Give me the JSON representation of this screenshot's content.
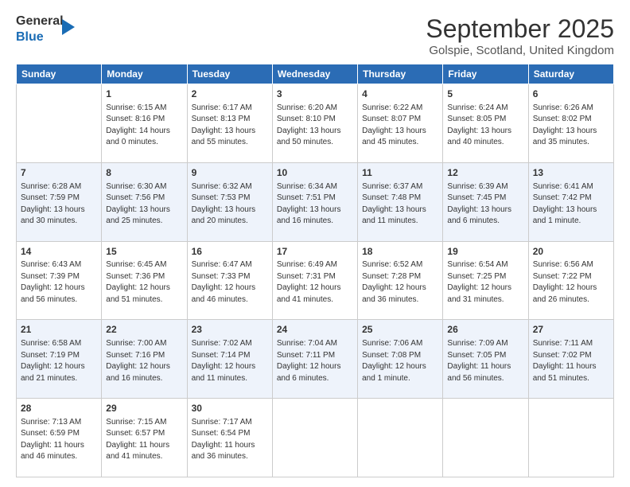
{
  "header": {
    "logo_general": "General",
    "logo_blue": "Blue",
    "title": "September 2025",
    "subtitle": "Golspie, Scotland, United Kingdom"
  },
  "days": [
    "Sunday",
    "Monday",
    "Tuesday",
    "Wednesday",
    "Thursday",
    "Friday",
    "Saturday"
  ],
  "weeks": [
    [
      {
        "num": "",
        "content": ""
      },
      {
        "num": "1",
        "content": "Sunrise: 6:15 AM\nSunset: 8:16 PM\nDaylight: 14 hours\nand 0 minutes."
      },
      {
        "num": "2",
        "content": "Sunrise: 6:17 AM\nSunset: 8:13 PM\nDaylight: 13 hours\nand 55 minutes."
      },
      {
        "num": "3",
        "content": "Sunrise: 6:20 AM\nSunset: 8:10 PM\nDaylight: 13 hours\nand 50 minutes."
      },
      {
        "num": "4",
        "content": "Sunrise: 6:22 AM\nSunset: 8:07 PM\nDaylight: 13 hours\nand 45 minutes."
      },
      {
        "num": "5",
        "content": "Sunrise: 6:24 AM\nSunset: 8:05 PM\nDaylight: 13 hours\nand 40 minutes."
      },
      {
        "num": "6",
        "content": "Sunrise: 6:26 AM\nSunset: 8:02 PM\nDaylight: 13 hours\nand 35 minutes."
      }
    ],
    [
      {
        "num": "7",
        "content": "Sunrise: 6:28 AM\nSunset: 7:59 PM\nDaylight: 13 hours\nand 30 minutes."
      },
      {
        "num": "8",
        "content": "Sunrise: 6:30 AM\nSunset: 7:56 PM\nDaylight: 13 hours\nand 25 minutes."
      },
      {
        "num": "9",
        "content": "Sunrise: 6:32 AM\nSunset: 7:53 PM\nDaylight: 13 hours\nand 20 minutes."
      },
      {
        "num": "10",
        "content": "Sunrise: 6:34 AM\nSunset: 7:51 PM\nDaylight: 13 hours\nand 16 minutes."
      },
      {
        "num": "11",
        "content": "Sunrise: 6:37 AM\nSunset: 7:48 PM\nDaylight: 13 hours\nand 11 minutes."
      },
      {
        "num": "12",
        "content": "Sunrise: 6:39 AM\nSunset: 7:45 PM\nDaylight: 13 hours\nand 6 minutes."
      },
      {
        "num": "13",
        "content": "Sunrise: 6:41 AM\nSunset: 7:42 PM\nDaylight: 13 hours\nand 1 minute."
      }
    ],
    [
      {
        "num": "14",
        "content": "Sunrise: 6:43 AM\nSunset: 7:39 PM\nDaylight: 12 hours\nand 56 minutes."
      },
      {
        "num": "15",
        "content": "Sunrise: 6:45 AM\nSunset: 7:36 PM\nDaylight: 12 hours\nand 51 minutes."
      },
      {
        "num": "16",
        "content": "Sunrise: 6:47 AM\nSunset: 7:33 PM\nDaylight: 12 hours\nand 46 minutes."
      },
      {
        "num": "17",
        "content": "Sunrise: 6:49 AM\nSunset: 7:31 PM\nDaylight: 12 hours\nand 41 minutes."
      },
      {
        "num": "18",
        "content": "Sunrise: 6:52 AM\nSunset: 7:28 PM\nDaylight: 12 hours\nand 36 minutes."
      },
      {
        "num": "19",
        "content": "Sunrise: 6:54 AM\nSunset: 7:25 PM\nDaylight: 12 hours\nand 31 minutes."
      },
      {
        "num": "20",
        "content": "Sunrise: 6:56 AM\nSunset: 7:22 PM\nDaylight: 12 hours\nand 26 minutes."
      }
    ],
    [
      {
        "num": "21",
        "content": "Sunrise: 6:58 AM\nSunset: 7:19 PM\nDaylight: 12 hours\nand 21 minutes."
      },
      {
        "num": "22",
        "content": "Sunrise: 7:00 AM\nSunset: 7:16 PM\nDaylight: 12 hours\nand 16 minutes."
      },
      {
        "num": "23",
        "content": "Sunrise: 7:02 AM\nSunset: 7:14 PM\nDaylight: 12 hours\nand 11 minutes."
      },
      {
        "num": "24",
        "content": "Sunrise: 7:04 AM\nSunset: 7:11 PM\nDaylight: 12 hours\nand 6 minutes."
      },
      {
        "num": "25",
        "content": "Sunrise: 7:06 AM\nSunset: 7:08 PM\nDaylight: 12 hours\nand 1 minute."
      },
      {
        "num": "26",
        "content": "Sunrise: 7:09 AM\nSunset: 7:05 PM\nDaylight: 11 hours\nand 56 minutes."
      },
      {
        "num": "27",
        "content": "Sunrise: 7:11 AM\nSunset: 7:02 PM\nDaylight: 11 hours\nand 51 minutes."
      }
    ],
    [
      {
        "num": "28",
        "content": "Sunrise: 7:13 AM\nSunset: 6:59 PM\nDaylight: 11 hours\nand 46 minutes."
      },
      {
        "num": "29",
        "content": "Sunrise: 7:15 AM\nSunset: 6:57 PM\nDaylight: 11 hours\nand 41 minutes."
      },
      {
        "num": "30",
        "content": "Sunrise: 7:17 AM\nSunset: 6:54 PM\nDaylight: 11 hours\nand 36 minutes."
      },
      {
        "num": "",
        "content": ""
      },
      {
        "num": "",
        "content": ""
      },
      {
        "num": "",
        "content": ""
      },
      {
        "num": "",
        "content": ""
      }
    ]
  ]
}
